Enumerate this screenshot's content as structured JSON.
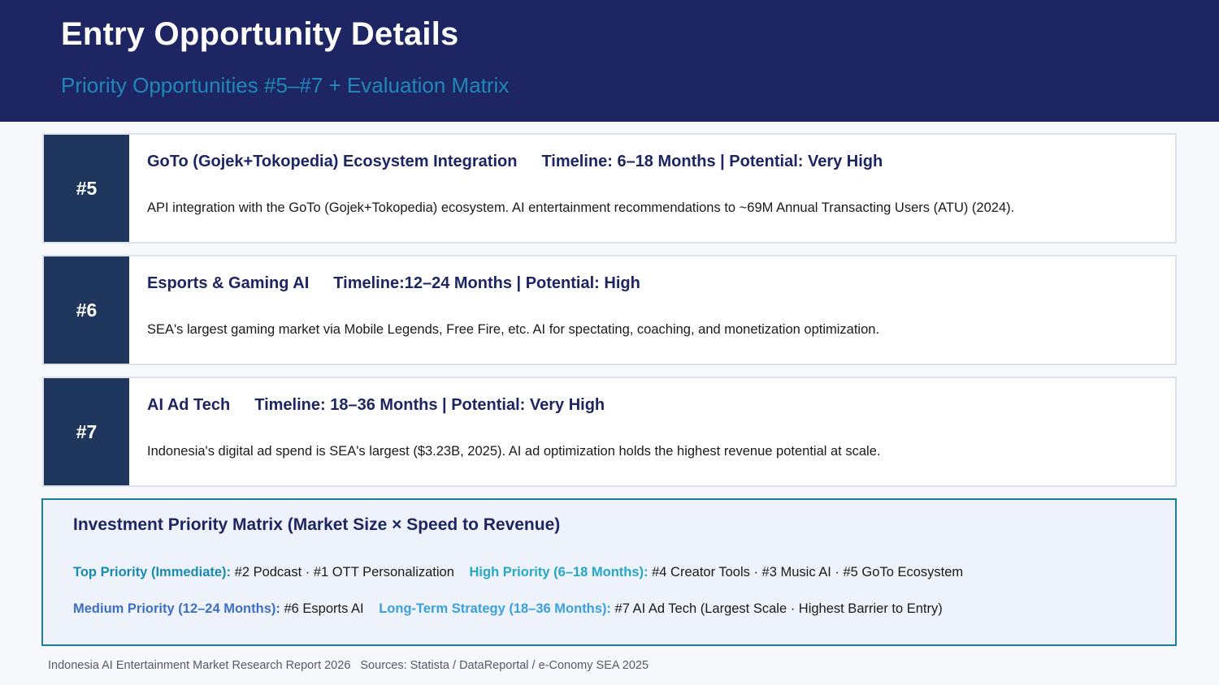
{
  "header": {
    "title": "Entry Opportunity Details",
    "subtitle": "Priority Opportunities #5–#7 + Evaluation Matrix"
  },
  "opportunities": [
    {
      "number": "#5",
      "name": "GoTo (Gojek+Tokopedia) Ecosystem Integration",
      "meta": "Timeline: 6–18 Months | Potential: Very High",
      "description": "API integration with the GoTo (Gojek+Tokopedia) ecosystem. AI entertainment recommendations to ~69M Annual Transacting Users (ATU) (2024)."
    },
    {
      "number": "#6",
      "name": "Esports & Gaming AI",
      "meta": "Timeline:12–24 Months | Potential: High",
      "description": "SEA's largest gaming market via Mobile Legends, Free Fire, etc. AI for spectating, coaching, and monetization optimization."
    },
    {
      "number": "#7",
      "name": "AI Ad Tech",
      "meta": "Timeline: 18–36 Months | Potential: Very High",
      "description": "Indonesia's digital ad spend is SEA's largest ($3.23B, 2025). AI ad optimization holds the highest revenue potential at scale."
    }
  ],
  "matrix": {
    "title": "Investment Priority Matrix (Market Size × Speed to Revenue)",
    "tiers": [
      {
        "label": "Top Priority (Immediate):",
        "items": "#2 Podcast · #1 OTT Personalization",
        "color": "#1a8bb0"
      },
      {
        "label": "High Priority (6–18 Months):",
        "items": "#4 Creator Tools · #3 Music AI · #5 GoTo Ecosystem",
        "color": "#26a6c9"
      },
      {
        "label": "Medium Priority (12–24 Months):",
        "items": "#6 Esports AI",
        "color": "#3f6fc4"
      },
      {
        "label": "Long-Term Strategy (18–36 Months):",
        "items": "#7 AI Ad Tech (Largest Scale · Highest Barrier to Entry)",
        "color": "#3aa0e0"
      }
    ]
  },
  "footer": {
    "report": "Indonesia AI Entertainment Market Research Report 2026",
    "sources": "Sources: Statista / DataReportal / e-Conomy SEA 2025"
  }
}
